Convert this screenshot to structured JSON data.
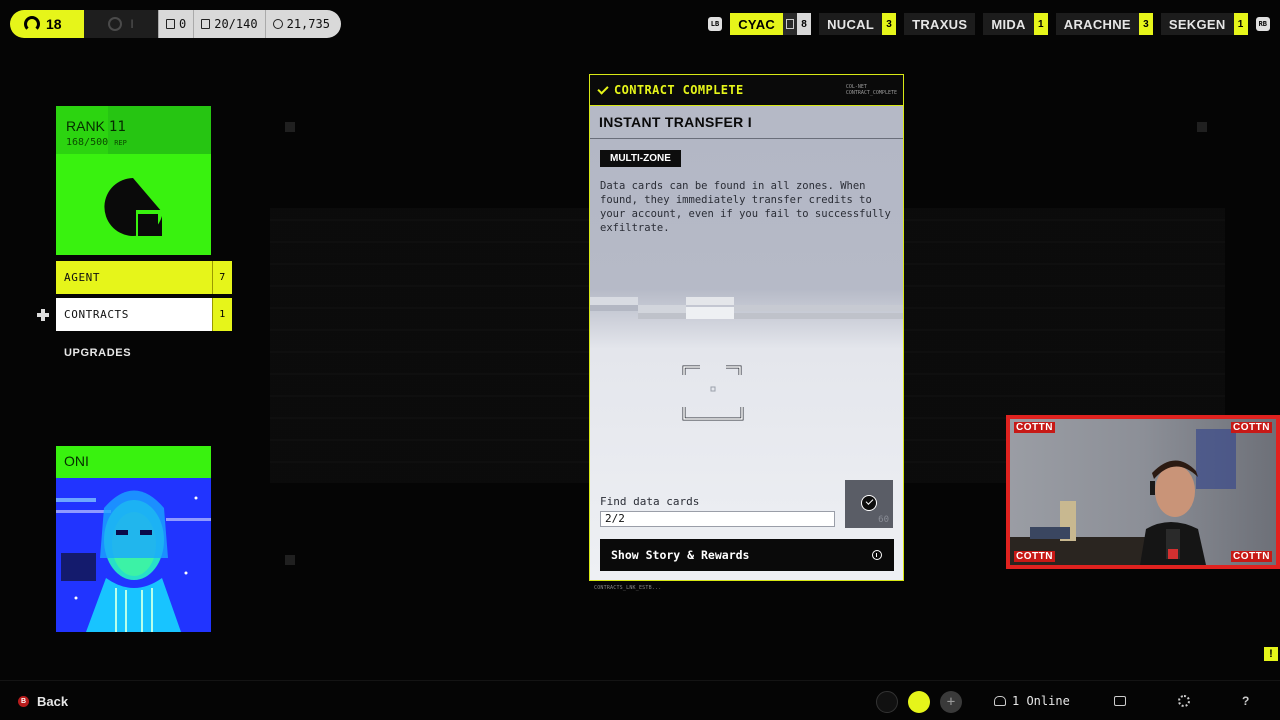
{
  "topbar": {
    "level": "18",
    "prestige": "I",
    "stats": [
      {
        "icon": "vault-icon",
        "value": "0"
      },
      {
        "icon": "backpack-icon",
        "value": "20/140"
      },
      {
        "icon": "credits-icon",
        "value": "21,735"
      }
    ],
    "left_hint": "LB",
    "right_hint": "RB"
  },
  "factions": [
    {
      "name": "CYAC",
      "count": "8",
      "active": true
    },
    {
      "name": "NUCAL",
      "count": "3"
    },
    {
      "name": "TRAXUS",
      "count": ""
    },
    {
      "name": "MIDA",
      "count": "1"
    },
    {
      "name": "ARACHNE",
      "count": "3"
    },
    {
      "name": "SEKGEN",
      "count": "1"
    }
  ],
  "rank": {
    "label": "RANK",
    "number": "11",
    "rep": "168/500",
    "rep_unit": "REP",
    "progress": 0.336
  },
  "menu": {
    "agent": {
      "label": "AGENT",
      "count": "7"
    },
    "contracts": {
      "label": "CONTRACTS",
      "count": "1"
    },
    "upgrades": {
      "label": "UPGRADES"
    }
  },
  "runner": {
    "name": "ONI"
  },
  "contract": {
    "status": "CONTRACT COMPLETE",
    "tag_line1": "COL-NET",
    "tag_line2": "CONTRACT_COMPLETE",
    "title": "INSTANT TRANSFER I",
    "zone": "MULTI-ZONE",
    "description": "Data cards can be found in all zones. When found, they immediately transfer credits to your account, even if you fail to successfully exfiltrate.",
    "objective_label": "Find data cards",
    "objective_progress": "2/2",
    "objective_points": "60",
    "story_button": "Show Story & Rewards",
    "footer_code": "CONTRACTS_LNK_ESTB..."
  },
  "webcam": {
    "tag": "COTTN"
  },
  "bottombar": {
    "back_hint": "B",
    "back_label": "Back",
    "online": "1 Online",
    "alert": "!"
  },
  "colors": {
    "accent": "#e6f51a",
    "rank_green": "#39f20f",
    "stream_red": "#e0221f"
  }
}
